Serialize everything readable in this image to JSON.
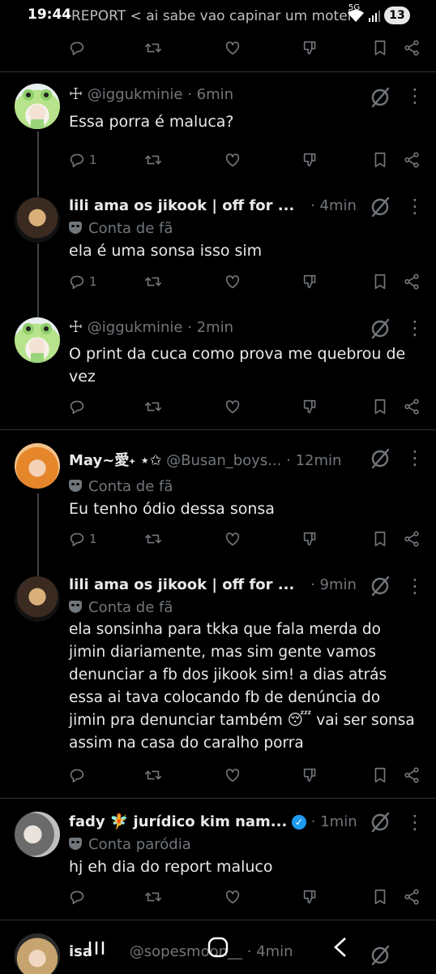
{
  "status_bar": {
    "time": "19:44",
    "ghost_text": "< ai sabe vao capinar um motel",
    "ghost_prefix": "REPORT",
    "badge": "13",
    "network": "5G"
  },
  "icons": {
    "reply": "reply-icon",
    "retweet": "retweet-icon",
    "like": "heart-icon",
    "downvote": "downvote-icon",
    "bookmark": "bookmark-icon",
    "share": "share-icon",
    "grok": "grok-icon",
    "more": "more-icon"
  },
  "colors": {
    "background": "#000000",
    "text": "#e7e9ea",
    "muted": "#71767b",
    "verified": "#1d9bf0",
    "divider": "#2f3336"
  },
  "posts": [
    {
      "prefix": "☩",
      "name": "",
      "handle": "@iggukminie",
      "time": "6min",
      "fan_label": "",
      "text": "Essa porra é maluca?",
      "reply_count": "1"
    },
    {
      "prefix": "",
      "name": "lili ama os jikook | off for ...",
      "handle": "",
      "time": "4min",
      "fan_label": "Conta de fã",
      "text": "ela é uma sonsa isso sim",
      "reply_count": "1"
    },
    {
      "prefix": "☩",
      "name": "",
      "handle": "@iggukminie",
      "time": "2min",
      "fan_label": "",
      "text": "O print da cuca como prova me quebrou de vez",
      "reply_count": ""
    },
    {
      "prefix": "",
      "name": "May~愛˖ ⋆✩",
      "handle": "@Busan_boys...",
      "time": "12min",
      "fan_label": "Conta de fã",
      "text": "Eu tenho ódio dessa sonsa",
      "reply_count": "1"
    },
    {
      "prefix": "",
      "name": "lili ama os jikook | off for ...",
      "handle": "",
      "time": "9min",
      "fan_label": "Conta de fã",
      "text": "ela sonsinha para tkka que fala merda do jimin diariamente, mas sim gente vamos denunciar a fb dos jikook sim! a dias atrás essa ai tava colocando fb de denúncia do jimin pra denunciar também 😴 vai ser sonsa assim na casa do caralho porra",
      "reply_count": ""
    },
    {
      "prefix": "",
      "name": "fady 🧚 jurídico kim nam...",
      "handle": "",
      "time": "1min",
      "fan_label": "Conta paródia",
      "text": "hj eh dia do report maluco",
      "reply_count": ""
    },
    {
      "prefix": "",
      "name": "isa",
      "handle": "@sopesmoon__",
      "time": "4min",
      "fan_label": "",
      "text": "",
      "reply_count": ""
    }
  ],
  "nav": {
    "recents": "recents-button",
    "home": "home-button",
    "back": "back-button"
  }
}
